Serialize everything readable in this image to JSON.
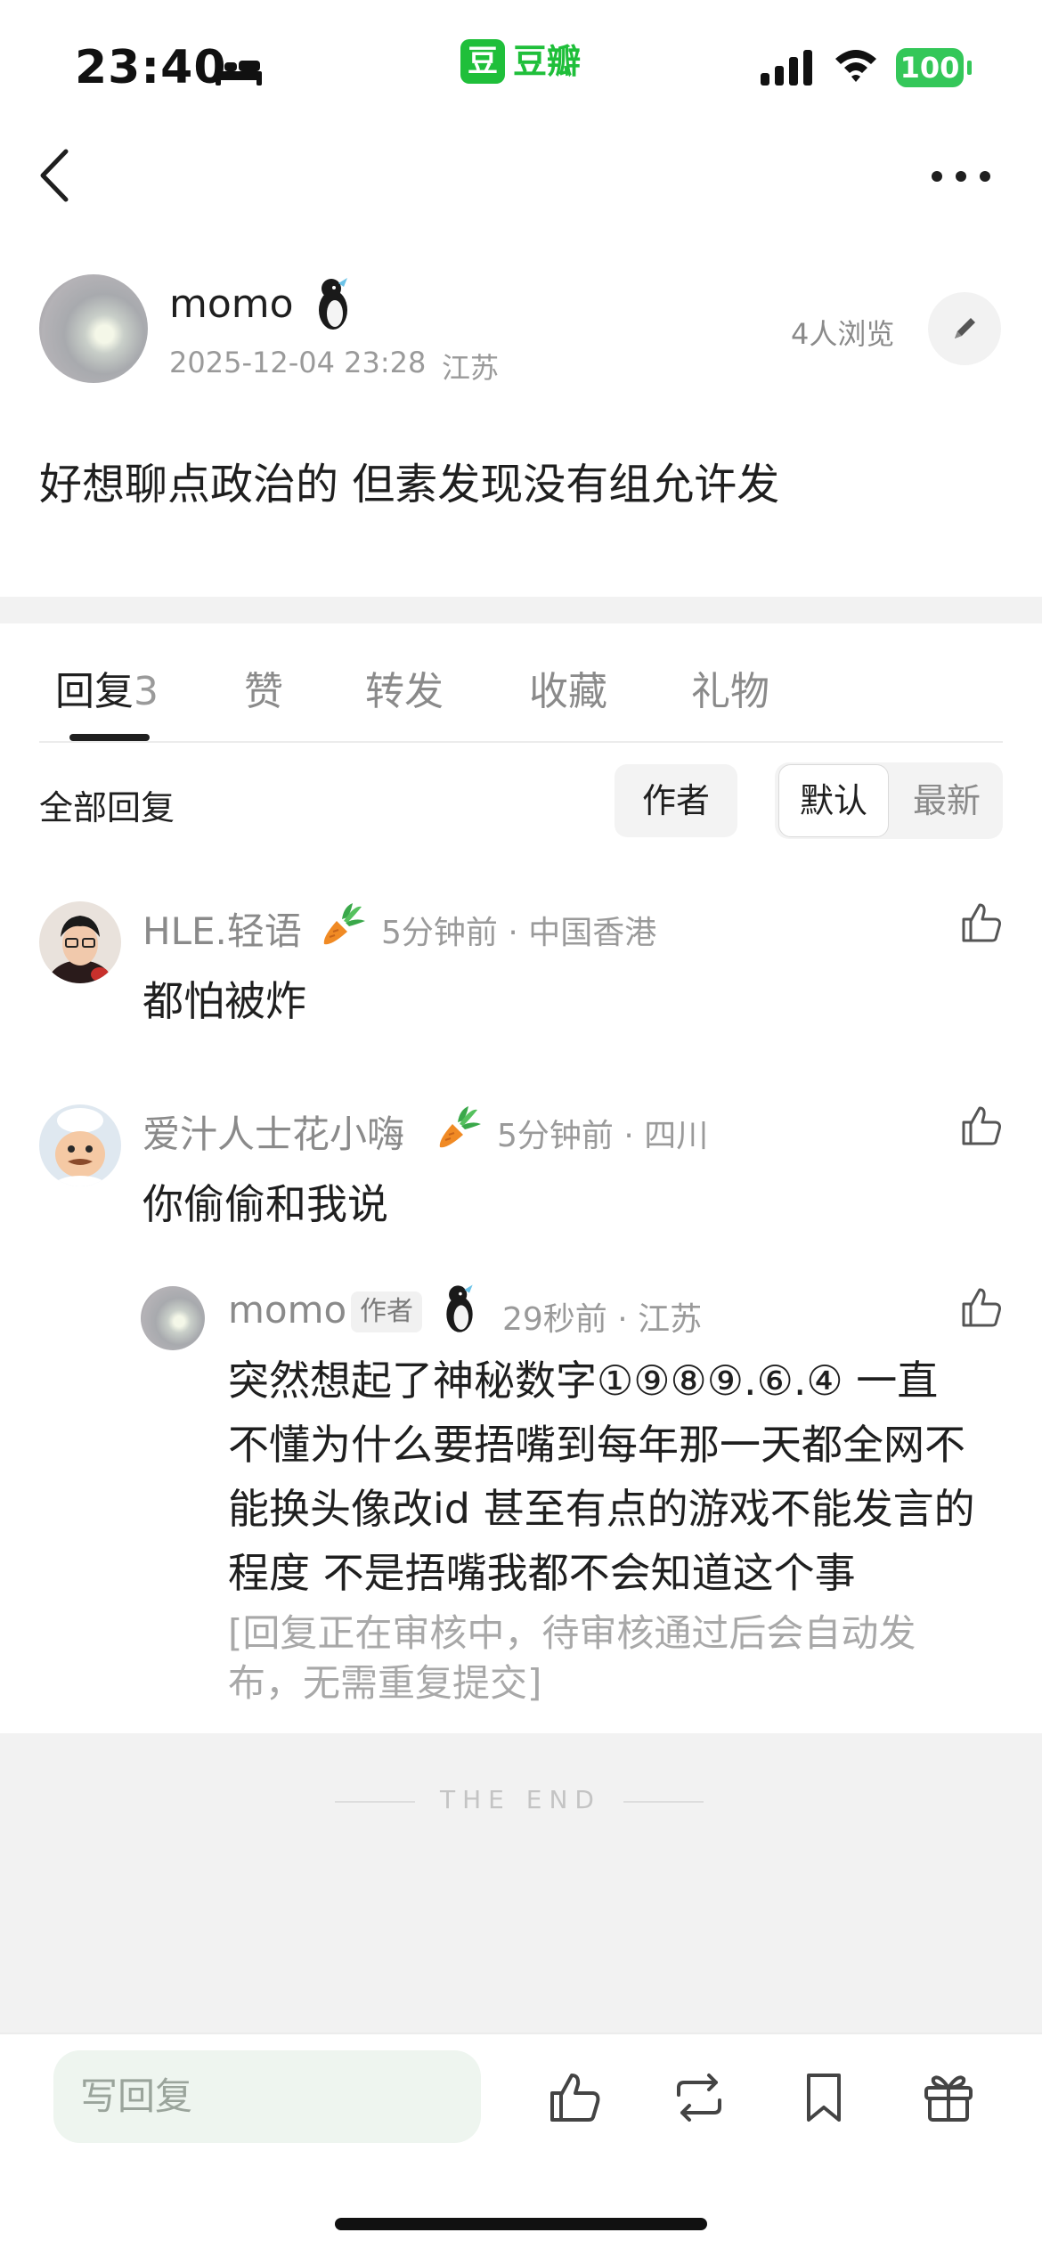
{
  "status_bar": {
    "time": "23:40",
    "app_badge": "豆",
    "app_name": "豆瓣",
    "battery": "100"
  },
  "post": {
    "author": "momo",
    "datetime": "2025-12-04 23:28",
    "location": "江苏",
    "views": "4人浏览",
    "body": "好想聊点政治的 但素发现没有组允许发"
  },
  "tabs": [
    {
      "label": "回复",
      "count": "3"
    },
    {
      "label": "赞"
    },
    {
      "label": "转发"
    },
    {
      "label": "收藏"
    },
    {
      "label": "礼物"
    }
  ],
  "filters": {
    "all": "全部回复",
    "author": "作者",
    "default": "默认",
    "latest": "最新"
  },
  "comments": [
    {
      "name": "HLE.轻语",
      "time": "5分钟前 · 中国香港",
      "text": "都怕被炸"
    },
    {
      "name": "爱汁人士花小嗨",
      "time": "5分钟前 · 四川",
      "text": "你偷偷和我说"
    }
  ],
  "reply": {
    "name": "momo",
    "tag": "作者",
    "time": "29秒前 · 江苏",
    "lines": [
      "突然想起了神秘数字①⑨⑧⑨.⑥.④ 一直",
      "不懂为什么要捂嘴到每年那一天都全网不",
      "能换头像改id 甚至有点的游戏不能发言的",
      "程度 不是捂嘴我都不会知道这个事"
    ],
    "review_lines": [
      "[回复正在审核中，待审核通过后会自动发",
      "布，无需重复提交]"
    ]
  },
  "end_text": "THE END",
  "bottom_bar": {
    "placeholder": "写回复"
  },
  "icons": [
    "bed-icon",
    "signal-icon",
    "wifi-icon",
    "back-icon",
    "more-icon",
    "pencil-icon",
    "carrot-icon",
    "thumbs-up-icon",
    "repost-icon",
    "bookmark-icon",
    "gift-icon"
  ],
  "colors": {
    "brand_green": "#1fbf3a",
    "battery_green": "#34c759",
    "muted_text": "#9a9a9a"
  }
}
